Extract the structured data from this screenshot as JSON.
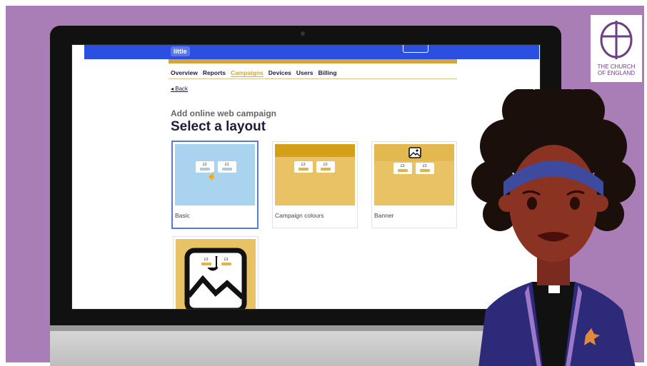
{
  "app": {
    "logo_text": "little"
  },
  "nav": {
    "tabs": [
      "Overview",
      "Reports",
      "Campaigns",
      "Devices",
      "Users",
      "Billing"
    ],
    "active": "Campaigns"
  },
  "back_label": "◂ Back",
  "page": {
    "subtitle": "Add online web campaign",
    "title": "Select a layout"
  },
  "layouts": [
    {
      "label": "Basic",
      "preview_color": "#a9d3ef",
      "selected": true
    },
    {
      "label": "Campaign colours",
      "preview_color": "#e8c265",
      "selected": false
    },
    {
      "label": "Banner",
      "preview_color": "#e8c265",
      "selected": false
    },
    {
      "label": "",
      "preview_color": "#e8c265",
      "selected": false
    }
  ],
  "mini_card_symbol": "£3",
  "overlay_logo": {
    "line1": "THE CHURCH",
    "line2": "OF ENGLAND"
  },
  "colors": {
    "brand_blue": "#2b4fe0",
    "gold": "#d4a53a",
    "background_purple": "#a97eb6",
    "logo_purple": "#6c3f86"
  }
}
